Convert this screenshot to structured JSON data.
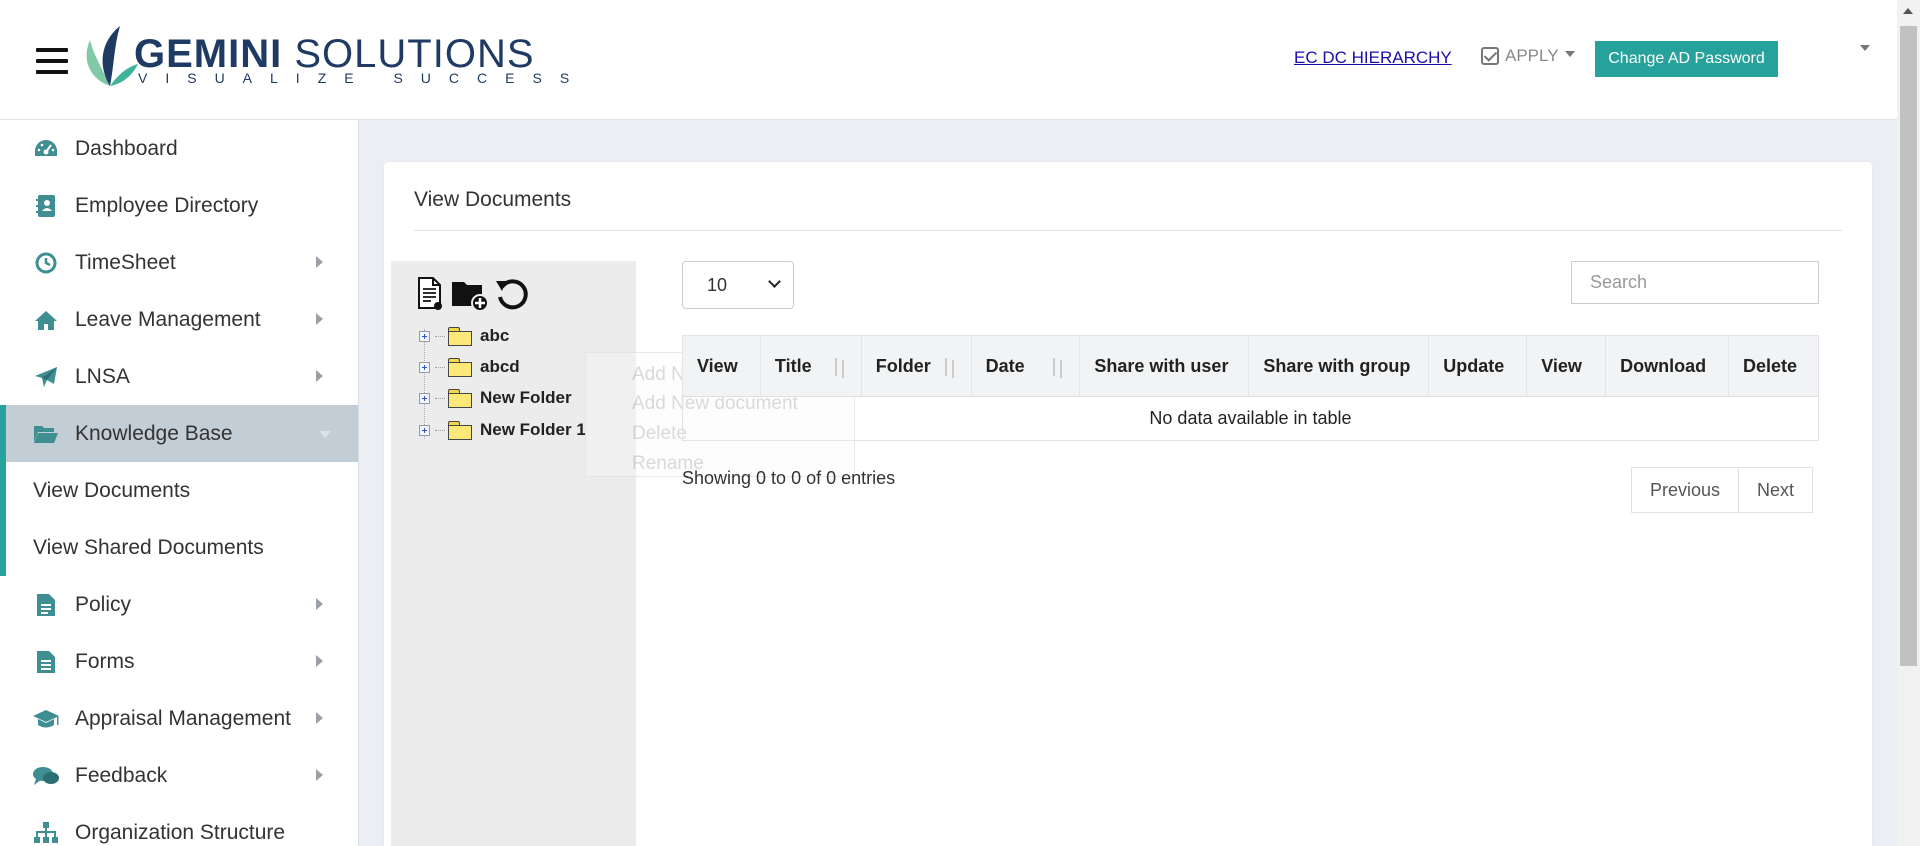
{
  "header": {
    "logo_word1": "GEMINI",
    "logo_word2": "SOLUTIONS",
    "logo_tagline": "VISUALIZE SUCCESS",
    "hierarchy_link": "EC DC HIERARCHY",
    "apply_label": "APPLY",
    "change_password_label": "Change AD Password"
  },
  "sidebar": {
    "items": [
      {
        "label": "Dashboard",
        "icon": "dashboard-icon"
      },
      {
        "label": "Employee Directory",
        "icon": "address-book-icon"
      },
      {
        "label": "TimeSheet",
        "icon": "clock-icon"
      },
      {
        "label": "Leave Management",
        "icon": "home-icon"
      },
      {
        "label": "LNSA",
        "icon": "paper-plane-icon"
      },
      {
        "label": "Knowledge Base",
        "icon": "folder-open-icon"
      },
      {
        "label": "View Documents"
      },
      {
        "label": "View Shared Documents"
      },
      {
        "label": "Policy",
        "icon": "document-icon"
      },
      {
        "label": "Forms",
        "icon": "form-icon"
      },
      {
        "label": "Appraisal Management",
        "icon": "graduation-cap-icon"
      },
      {
        "label": "Feedback",
        "icon": "comments-icon"
      },
      {
        "label": "Organization Structure",
        "icon": "sitemap-icon"
      }
    ],
    "accent_color": "#26a19b"
  },
  "main": {
    "title": "View Documents",
    "tree": {
      "folders": [
        "abc",
        "abcd",
        "New Folder",
        "New Folder 1"
      ]
    },
    "context_menu": [
      "Add New folder",
      "Add New document",
      "Delete",
      "Rename"
    ],
    "page_length": "10",
    "search_placeholder": "Search",
    "table": {
      "columns": [
        "View",
        "Title",
        "Folder",
        "Date",
        "Share with user",
        "Share with group",
        "Update",
        "View",
        "Download",
        "Delete"
      ],
      "empty_message": "No data available in table"
    },
    "info": "Showing 0 to 0 of 0 entries",
    "pager": {
      "previous": "Previous",
      "next": "Next"
    }
  }
}
